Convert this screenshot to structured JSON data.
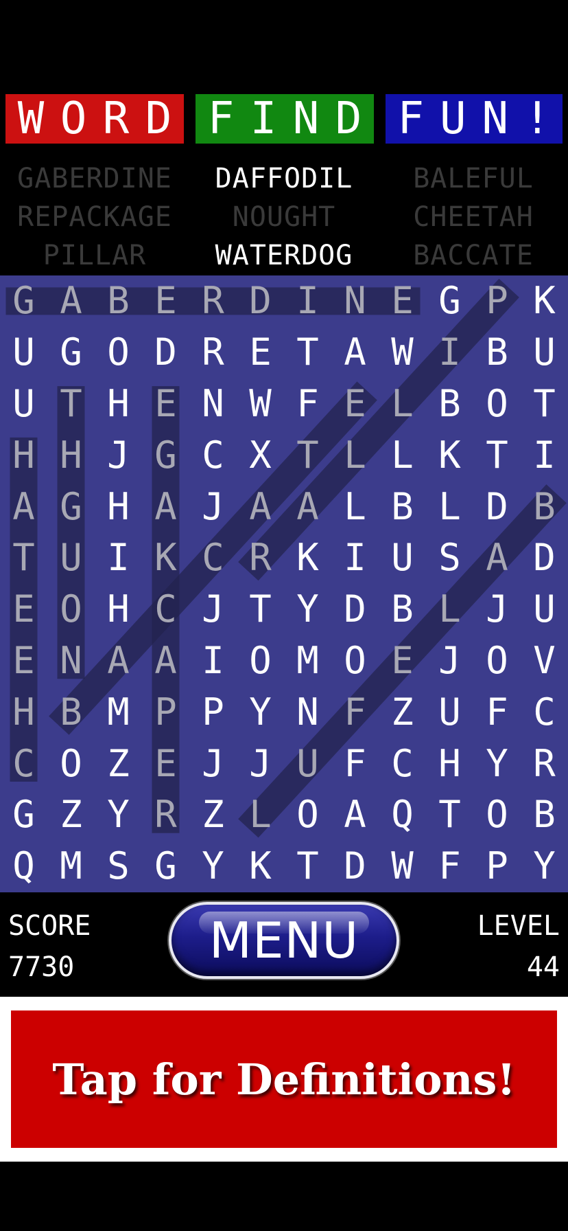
{
  "title": {
    "words": [
      {
        "text": "WORD",
        "color": "#cc1111"
      },
      {
        "text": "FIND",
        "color": "#118811"
      },
      {
        "text": "FUN!",
        "color": "#1111aa"
      }
    ]
  },
  "word_list": [
    {
      "text": "GABERDINE",
      "found": true
    },
    {
      "text": "DAFFODIL",
      "found": false
    },
    {
      "text": "BALEFUL",
      "found": true
    },
    {
      "text": "REPACKAGE",
      "found": true
    },
    {
      "text": "NOUGHT",
      "found": true
    },
    {
      "text": "CHEETAH",
      "found": true
    },
    {
      "text": "PILLAR",
      "found": true
    },
    {
      "text": "WATERDOG",
      "found": false
    },
    {
      "text": "BACCATE",
      "found": true
    }
  ],
  "colors": {
    "found_word": "#3a3a3a",
    "remaining_word": "#ffffff",
    "grid_background": "#3c3c8c"
  },
  "grid": [
    "GABERDINEGPK",
    "UGODRETAWIBU",
    "UTHENWFELBOT",
    "HHJGCXTLLKTI",
    "AGHAJAALBLDB",
    "TUIKCRKIUSAD",
    "EOHCJTYDBLJU",
    "ENAAIOMOEJOV",
    "HBMPPYNFZUFC",
    "COZEJJUFCHYR",
    "GZYRZLOAQTOB",
    "QMSGYKTDWFPY"
  ],
  "found_paths": [
    {
      "word": "GABERDINE",
      "start": [
        0,
        0
      ],
      "end": [
        0,
        8
      ]
    },
    {
      "word": "CHEETAH",
      "start": [
        9,
        0
      ],
      "end": [
        3,
        0
      ]
    },
    {
      "word": "NOUGHT",
      "start": [
        7,
        1
      ],
      "end": [
        2,
        1
      ]
    },
    {
      "word": "REPACKAGE",
      "start": [
        10,
        3
      ],
      "end": [
        2,
        3
      ]
    },
    {
      "word": "BALEFUL",
      "start": [
        8,
        1
      ],
      "end": [
        2,
        7
      ]
    },
    {
      "word": "PILLAR",
      "start": [
        0,
        10
      ],
      "end": [
        5,
        5
      ]
    },
    {
      "word": "BACCATE",
      "start": [
        4,
        11
      ],
      "end": [
        10,
        5
      ]
    }
  ],
  "score": {
    "label": "SCORE",
    "value": "7730"
  },
  "level": {
    "label": "LEVEL",
    "value": "44"
  },
  "menu": {
    "label": "MENU"
  },
  "definitions": {
    "label": "Tap for Definitions!"
  }
}
